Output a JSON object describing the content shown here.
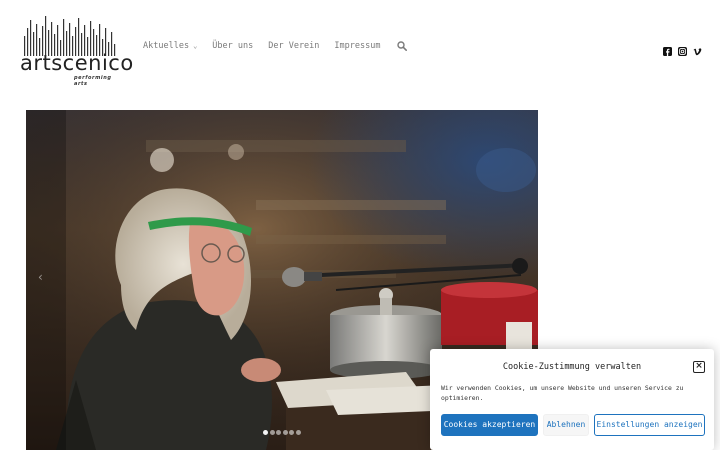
{
  "header": {
    "logo": {
      "word": "artscenico",
      "tagline": "performing arts"
    },
    "nav": [
      {
        "label": "Aktuelles",
        "has_dropdown": true,
        "icon": "chevron-down-icon"
      },
      {
        "label": "Über uns"
      },
      {
        "label": "Der Verein"
      },
      {
        "label": "Impressum"
      }
    ],
    "search_icon": "search-icon",
    "social": [
      "facebook-icon",
      "instagram-icon",
      "vimeo-icon"
    ]
  },
  "slider": {
    "prev_icon": "chevron-left-icon",
    "prev_glyph": "‹",
    "dots_count": 6,
    "active_dot": 0
  },
  "cookie": {
    "title": "Cookie-Zustimmung verwalten",
    "close_glyph": "×",
    "text": "Wir verwenden Cookies, um unsere Website und unseren Service zu optimieren.",
    "accept_label": "Cookies akzeptieren",
    "deny_label": "Ablehnen",
    "settings_label": "Einstellungen anzeigen"
  },
  "colors": {
    "accent": "#1e73be",
    "nav_text": "#7a7a7a"
  }
}
